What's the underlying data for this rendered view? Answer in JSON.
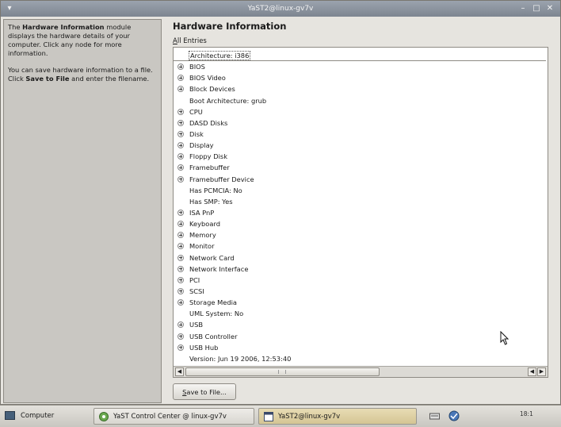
{
  "window": {
    "title": "YaST2@linux-gv7v"
  },
  "help": {
    "p1_pre": "The ",
    "p1_bold": "Hardware Information",
    "p1_post": " module displays the hardware details of your computer. Click any node for more information.",
    "p2_pre": "You can save hardware information to a file. Click ",
    "p2_bold": "Save to File",
    "p2_post": " and enter the filename."
  },
  "main": {
    "title": "Hardware Information",
    "all_entries_mnemonic": "A",
    "all_entries_rest": "ll Entries"
  },
  "tree": {
    "items": [
      {
        "label": "Architecture: i386",
        "expandable": false,
        "selected": true
      },
      {
        "label": "BIOS",
        "expandable": true
      },
      {
        "label": "BIOS Video",
        "expandable": true
      },
      {
        "label": "Block Devices",
        "expandable": true
      },
      {
        "label": "Boot Architecture: grub",
        "expandable": false
      },
      {
        "label": "CPU",
        "expandable": true
      },
      {
        "label": "DASD Disks",
        "expandable": true
      },
      {
        "label": "Disk",
        "expandable": true
      },
      {
        "label": "Display",
        "expandable": true
      },
      {
        "label": "Floppy Disk",
        "expandable": true
      },
      {
        "label": "Framebuffer",
        "expandable": true
      },
      {
        "label": "Framebuffer Device",
        "expandable": true
      },
      {
        "label": "Has PCMCIA: No",
        "expandable": false
      },
      {
        "label": "Has SMP: Yes",
        "expandable": false
      },
      {
        "label": "ISA PnP",
        "expandable": true
      },
      {
        "label": "Keyboard",
        "expandable": true
      },
      {
        "label": "Memory",
        "expandable": true
      },
      {
        "label": "Monitor",
        "expandable": true
      },
      {
        "label": "Network Card",
        "expandable": true
      },
      {
        "label": "Network Interface",
        "expandable": true
      },
      {
        "label": "PCI",
        "expandable": true
      },
      {
        "label": "SCSI",
        "expandable": true
      },
      {
        "label": "Storage Media",
        "expandable": true
      },
      {
        "label": "UML System: No",
        "expandable": false
      },
      {
        "label": "USB",
        "expandable": true
      },
      {
        "label": "USB Controller",
        "expandable": true
      },
      {
        "label": "USB Hub",
        "expandable": true
      },
      {
        "label": "Version: Jun 19 2006, 12:53:40",
        "expandable": false
      }
    ]
  },
  "buttons": {
    "save_mnemonic": "S",
    "save_rest": "ave to File..."
  },
  "taskbar": {
    "computer_label": "Computer",
    "tasks": [
      {
        "label": "YaST Control Center @ linux-gv7v"
      },
      {
        "label": "YaST2@linux-gv7v"
      }
    ],
    "clock": "18:1"
  }
}
